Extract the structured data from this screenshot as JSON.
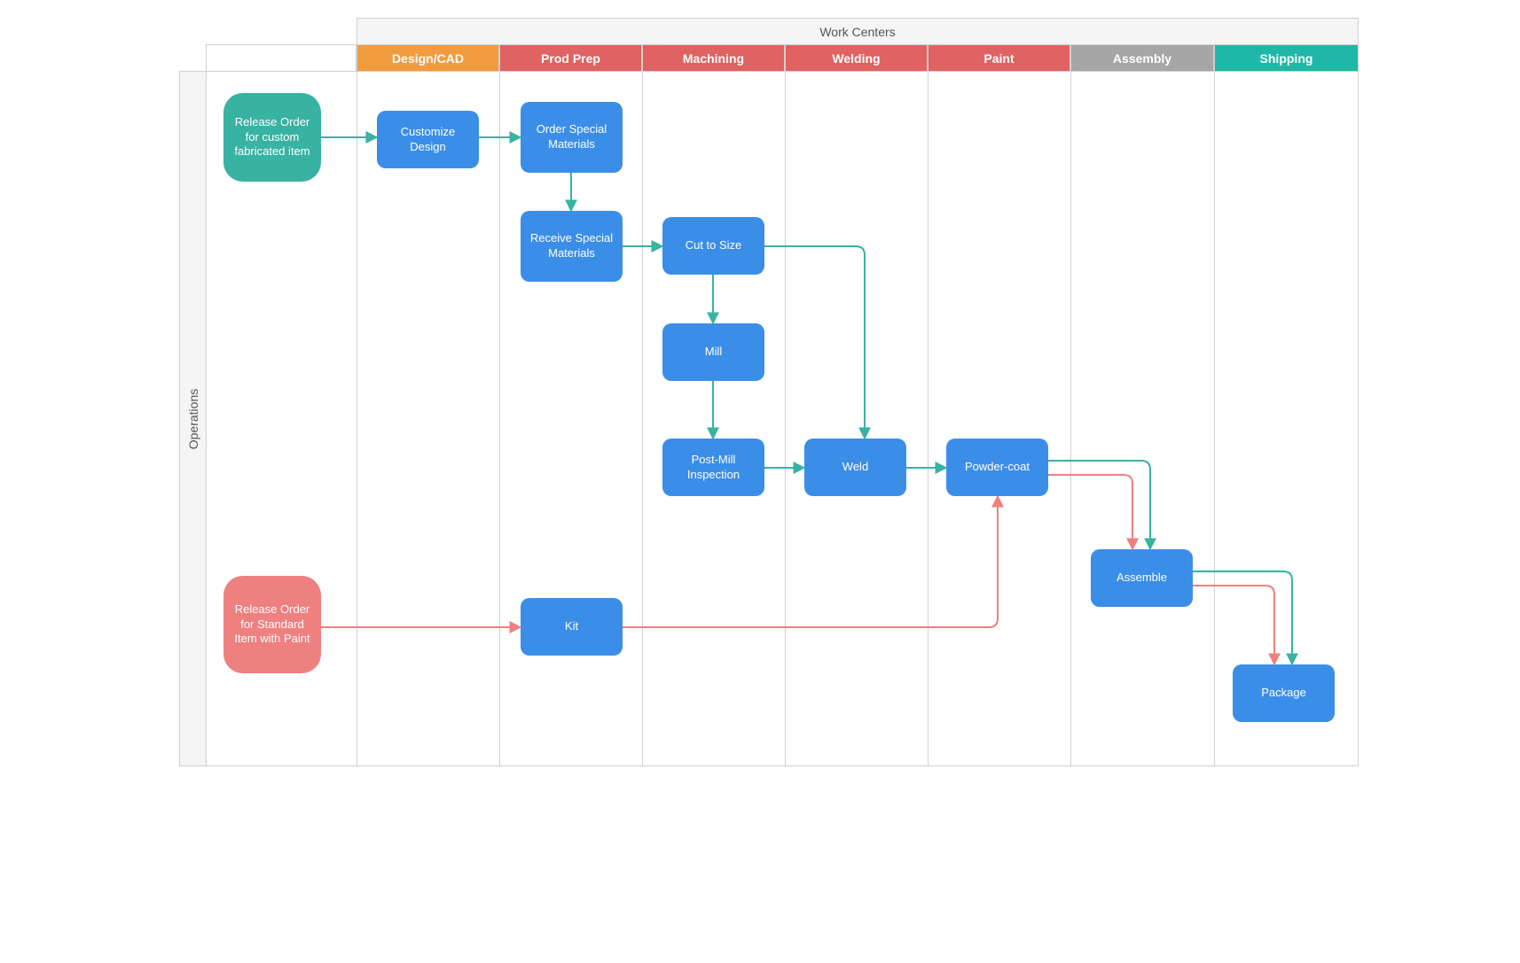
{
  "headers": {
    "top": "Work Centers",
    "left": "Operations"
  },
  "columns": [
    {
      "label": "Design/CAD",
      "cls": "orange"
    },
    {
      "label": "Prod Prep",
      "cls": "coral"
    },
    {
      "label": "Machining",
      "cls": "coral"
    },
    {
      "label": "Welding",
      "cls": "coral"
    },
    {
      "label": "Paint",
      "cls": "coral"
    },
    {
      "label": "Assembly",
      "cls": "gray"
    },
    {
      "label": "Shipping",
      "cls": "teal"
    }
  ],
  "nodes": {
    "release_custom": "Release Order for custom fabricated item",
    "release_standard": "Release Order for Standard Item with Paint",
    "customize_design": "Customize Design",
    "order_materials": "Order Special Materials",
    "receive_materials": "Receive Special Materials",
    "cut_to_size": "Cut to Size",
    "mill": "Mill",
    "post_mill": "Post-Mill Inspection",
    "weld": "Weld",
    "powder_coat": "Powder-coat",
    "assemble": "Assemble",
    "package": "Package",
    "kit": "Kit"
  },
  "colors": {
    "teal_line": "#38b2a3",
    "coral_line": "#ef8080"
  }
}
